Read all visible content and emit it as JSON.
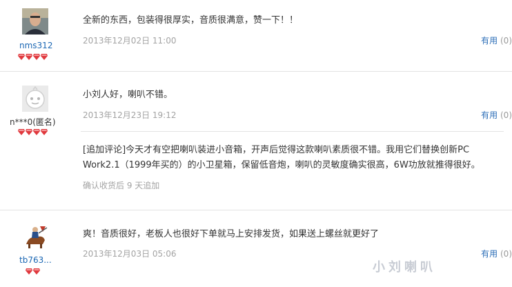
{
  "reviews": [
    {
      "username": "nms312",
      "avatar_icon": "user-photo-icon",
      "content": "全新的东西，包装得很厚实，音质很满意，赞一下！！",
      "date": "2013年12月02日 11:00",
      "useful_label": "有用",
      "useful_count": "(0)",
      "gems": 4
    },
    {
      "username": "n***0(匿名)",
      "avatar_icon": "anonymous-avatar-icon",
      "content": "小刘人好，喇叭不错。",
      "date": "2013年12月23日 19:12",
      "useful_label": "有用",
      "useful_count": "(0)",
      "gems": 4,
      "followup": {
        "text_line1": "[追加评论]今天才有空把喇叭装进小音箱，开声后觉得这款喇叭素质很不错。我用它们替换创新PC",
        "text_line2": "Work2.1（1999年买的）的小卫星箱，保留低音炮，喇叭的灵敏度确实很高，6W功放就推得很好。",
        "note": "确认收货后 9 天追加"
      }
    },
    {
      "username": "tb763...",
      "avatar_icon": "knight-avatar-icon",
      "content": "爽！音质很好，老板人也很好下单就马上安排发货，如果送上螺丝就更好了",
      "date": "2013年12月03日 05:06",
      "useful_label": "有用",
      "useful_count": "(0)",
      "gems": 2
    }
  ],
  "watermark": "小刘喇叭",
  "colors": {
    "gem": "#e0393e",
    "link": "#2e6fb8",
    "date": "#a3a3a3"
  }
}
